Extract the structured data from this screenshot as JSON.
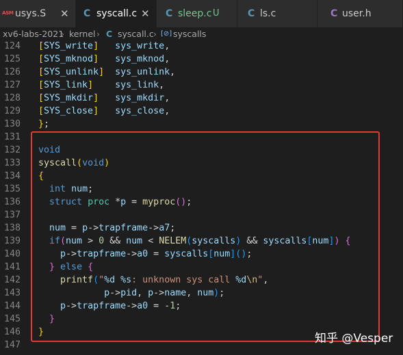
{
  "tabs": [
    {
      "icon": "ASM",
      "label": "usys.S",
      "close": "✕",
      "label_color": "#cccccc"
    },
    {
      "icon": "C",
      "label": "syscall.c",
      "close": "✕",
      "label_color": "#ffffff"
    },
    {
      "icon": "C",
      "label": "sleep.c",
      "badge": "U",
      "label_color": "#73c991"
    },
    {
      "icon": "C",
      "label": "ls.c",
      "label_color": "#cccccc"
    },
    {
      "icon": "C",
      "label": "user.h",
      "label_color": "#cccccc"
    }
  ],
  "breadcrumb": {
    "parts": [
      "xv6-labs-2021",
      "kernel",
      "syscall.c",
      "syscalls"
    ],
    "file_icon": "C",
    "symbol_icon": "[⊘]",
    "sep": "›"
  },
  "code_lines": [
    {
      "num": "124",
      "text": "[SYS_write]   sys_write,"
    },
    {
      "num": "125",
      "text": "[SYS_mknod]   sys_mknod,"
    },
    {
      "num": "126",
      "text": "[SYS_unlink]  sys_unlink,"
    },
    {
      "num": "127",
      "text": "[SYS_link]    sys_link,"
    },
    {
      "num": "128",
      "text": "[SYS_mkdir]   sys_mkdir,"
    },
    {
      "num": "129",
      "text": "[SYS_close]   sys_close,"
    },
    {
      "num": "130",
      "text": "};"
    },
    {
      "num": "131",
      "text": ""
    },
    {
      "num": "132",
      "text": "void"
    },
    {
      "num": "133",
      "text": "syscall(void)"
    },
    {
      "num": "134",
      "text": "{"
    },
    {
      "num": "135",
      "text": "  int num;"
    },
    {
      "num": "136",
      "text": "  struct proc *p = myproc();"
    },
    {
      "num": "137",
      "text": ""
    },
    {
      "num": "138",
      "text": "  num = p->trapframe->a7;"
    },
    {
      "num": "139",
      "text": "  if(num > 0 && num < NELEM(syscalls) && syscalls[num]) {"
    },
    {
      "num": "140",
      "text": "    p->trapframe->a0 = syscalls[num]();"
    },
    {
      "num": "141",
      "text": "  } else {"
    },
    {
      "num": "142",
      "text": "    printf(\"%d %s: unknown sys call %d\\n\","
    },
    {
      "num": "143",
      "text": "            p->pid, p->name, num);"
    },
    {
      "num": "144",
      "text": "    p->trapframe->a0 = -1;"
    },
    {
      "num": "145",
      "text": "  }"
    },
    {
      "num": "146",
      "text": "}"
    },
    {
      "num": "147",
      "text": ""
    }
  ],
  "watermark": "知乎 @Vesper",
  "colors": {
    "bg": "#1e1e1e",
    "keyword": "#569cd6",
    "function": "#dcdcaa",
    "variable": "#9cdcfe",
    "string": "#ce9178",
    "number": "#b5cea8",
    "type": "#4ec9b0",
    "macro": "#c586c0",
    "escape": "#d7ba7d",
    "bracket_yellow": "#ffd700",
    "bracket_purple": "#da70d6",
    "bracket_blue": "#179fff",
    "highlight_border": "#e53935"
  }
}
